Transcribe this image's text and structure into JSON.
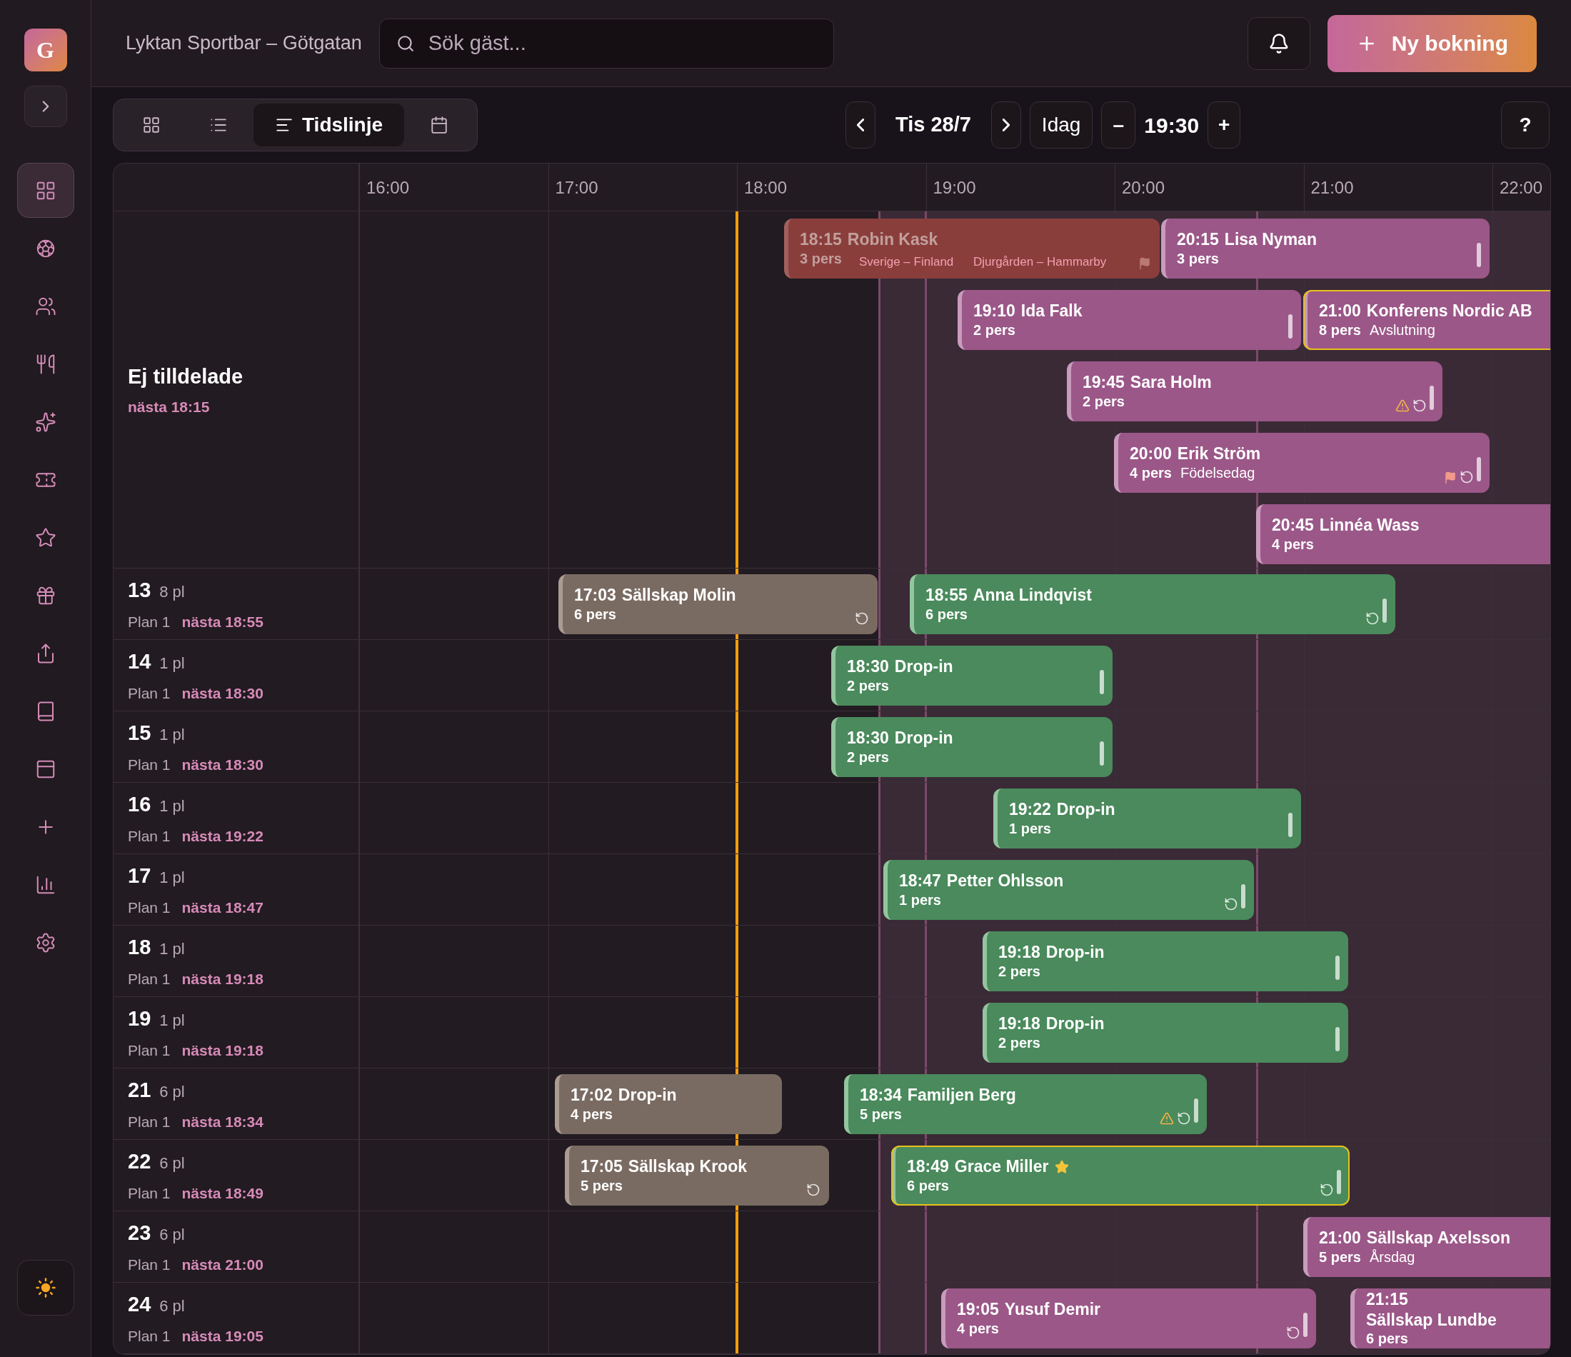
{
  "sidebar": {
    "logo_letter": "G",
    "nav_items": [
      {
        "kind": "grid",
        "selected": true
      },
      {
        "kind": "ball",
        "selected": false
      },
      {
        "kind": "users",
        "selected": false
      },
      {
        "kind": "utensils",
        "selected": false
      },
      {
        "kind": "sparkles",
        "selected": false
      },
      {
        "kind": "ticket",
        "selected": false
      },
      {
        "kind": "star",
        "selected": false
      },
      {
        "kind": "gift",
        "selected": false
      },
      {
        "kind": "share",
        "selected": false
      },
      {
        "kind": "book",
        "selected": false
      },
      {
        "kind": "panel",
        "selected": false
      },
      {
        "kind": "plus",
        "selected": false
      },
      {
        "kind": "chart",
        "selected": false
      },
      {
        "kind": "settings",
        "selected": false
      }
    ]
  },
  "header": {
    "title": "Lyktan Sportbar – Götgatan",
    "search": {
      "placeholder": "Sök gäst..."
    },
    "new_booking_button": "Ny bokning"
  },
  "view_tabs": [
    {
      "kind": "grid",
      "selected": false
    },
    {
      "kind": "list",
      "selected": false
    },
    {
      "kind": "timeline",
      "label": "Tidslinje",
      "selected": true
    },
    {
      "kind": "calendar",
      "selected": false
    }
  ],
  "date_nav": {
    "date": "Tis 28/7",
    "today_button": "Idag",
    "minus_button": "–",
    "time": "19:30",
    "plus_button": "+"
  },
  "help_button": "?",
  "timeline": {
    "hours": [
      "16:00",
      "17:00",
      "18:00",
      "19:00",
      "20:00",
      "21:00",
      "22:00"
    ],
    "events": [
      "Sverige – Finland",
      "Djurgården – Hammarby"
    ],
    "unassigned": {
      "title": "Ej tilldelade",
      "next": "nästa 18:15",
      "bookings": [
        {
          "time": "18:15",
          "name": "Robin Kask",
          "party": "3 pers",
          "kind": "cancelled",
          "highlighted": false,
          "starred": false,
          "handle": false,
          "warning": false,
          "repeat": false,
          "flag": true
        },
        {
          "time": "20:15",
          "name": "Lisa Nyman",
          "party": "3 pers",
          "kind": "booked",
          "highlighted": false,
          "starred": false,
          "handle": true,
          "warning": false,
          "repeat": false,
          "flag": false
        },
        {
          "time": "19:10",
          "name": "Ida Falk",
          "party": "2 pers",
          "kind": "booked",
          "highlighted": false,
          "starred": false,
          "handle": true,
          "warning": false,
          "repeat": false,
          "flag": false
        },
        {
          "time": "21:00",
          "name": "Konferens Nordic AB",
          "party": "8 pers",
          "note": "Avslutning",
          "kind": "booked",
          "highlighted": true,
          "starred": false,
          "handle": false,
          "warning": false,
          "repeat": false,
          "flag": false
        },
        {
          "time": "19:45",
          "name": "Sara Holm",
          "party": "2 pers",
          "kind": "booked",
          "highlighted": false,
          "starred": false,
          "handle": true,
          "warning": true,
          "repeat": true,
          "flag": false
        },
        {
          "time": "20:00",
          "name": "Erik Ström",
          "party": "4 pers",
          "note": "Födelsedag",
          "kind": "booked",
          "highlighted": false,
          "starred": false,
          "handle": true,
          "warning": false,
          "repeat": true,
          "flag": true
        },
        {
          "time": "20:45",
          "name": "Linnéa Wass",
          "party": "4 pers",
          "kind": "booked",
          "highlighted": false,
          "starred": false,
          "handle": false,
          "warning": false,
          "repeat": false,
          "flag": false
        }
      ]
    },
    "tables": [
      {
        "number": "13",
        "seats": "8 pl",
        "area": "Plan 1",
        "next": "nästa 18:55",
        "bookings": [
          {
            "time": "17:03",
            "name": "Sällskap Molin",
            "party": "6 pers",
            "kind": "finished",
            "highlighted": false,
            "starred": false,
            "handle": false,
            "warning": false,
            "repeat": true,
            "flag": false
          },
          {
            "time": "18:55",
            "name": "Anna Lindqvist",
            "party": "6 pers",
            "kind": "seated",
            "highlighted": false,
            "starred": false,
            "handle": true,
            "warning": false,
            "repeat": true,
            "flag": false
          }
        ]
      },
      {
        "number": "14",
        "seats": "1 pl",
        "area": "Plan 1",
        "next": "nästa 18:30",
        "bookings": [
          {
            "time": "18:30",
            "name": "Drop-in",
            "party": "2 pers",
            "kind": "seated",
            "highlighted": false,
            "starred": false,
            "handle": true,
            "warning": false,
            "repeat": false,
            "flag": false
          }
        ]
      },
      {
        "number": "15",
        "seats": "1 pl",
        "area": "Plan 1",
        "next": "nästa 18:30",
        "bookings": [
          {
            "time": "18:30",
            "name": "Drop-in",
            "party": "2 pers",
            "kind": "seated",
            "highlighted": false,
            "starred": false,
            "handle": true,
            "warning": false,
            "repeat": false,
            "flag": false
          }
        ]
      },
      {
        "number": "16",
        "seats": "1 pl",
        "area": "Plan 1",
        "next": "nästa 19:22",
        "bookings": [
          {
            "time": "19:22",
            "name": "Drop-in",
            "party": "1 pers",
            "kind": "seated",
            "highlighted": false,
            "starred": false,
            "handle": true,
            "warning": false,
            "repeat": false,
            "flag": false
          }
        ]
      },
      {
        "number": "17",
        "seats": "1 pl",
        "area": "Plan 1",
        "next": "nästa 18:47",
        "bookings": [
          {
            "time": "18:47",
            "name": "Petter Ohlsson",
            "party": "1 pers",
            "kind": "seated",
            "highlighted": false,
            "starred": false,
            "handle": true,
            "warning": false,
            "repeat": true,
            "flag": false
          }
        ]
      },
      {
        "number": "18",
        "seats": "1 pl",
        "area": "Plan 1",
        "next": "nästa 19:18",
        "bookings": [
          {
            "time": "19:18",
            "name": "Drop-in",
            "party": "2 pers",
            "kind": "seated",
            "highlighted": false,
            "starred": false,
            "handle": true,
            "warning": false,
            "repeat": false,
            "flag": false
          }
        ]
      },
      {
        "number": "19",
        "seats": "1 pl",
        "area": "Plan 1",
        "next": "nästa 19:18",
        "bookings": [
          {
            "time": "19:18",
            "name": "Drop-in",
            "party": "2 pers",
            "kind": "seated",
            "highlighted": false,
            "starred": false,
            "handle": true,
            "warning": false,
            "repeat": false,
            "flag": false
          }
        ]
      },
      {
        "number": "21",
        "seats": "6 pl",
        "area": "Plan 1",
        "next": "nästa 18:34",
        "bookings": [
          {
            "time": "17:02",
            "name": "Drop-in",
            "party": "4 pers",
            "kind": "finished",
            "highlighted": false,
            "starred": false,
            "handle": false,
            "warning": false,
            "repeat": false,
            "flag": false
          },
          {
            "time": "18:34",
            "name": "Familjen Berg",
            "party": "5 pers",
            "kind": "seated",
            "highlighted": false,
            "starred": false,
            "handle": true,
            "warning": true,
            "repeat": true,
            "flag": false
          }
        ]
      },
      {
        "number": "22",
        "seats": "6 pl",
        "area": "Plan 1",
        "next": "nästa 18:49",
        "bookings": [
          {
            "time": "17:05",
            "name": "Sällskap Krook",
            "party": "5 pers",
            "kind": "finished",
            "highlighted": false,
            "starred": false,
            "handle": false,
            "warning": false,
            "repeat": true,
            "flag": false
          },
          {
            "time": "18:49",
            "name": "Grace Miller",
            "party": "6 pers",
            "kind": "seated",
            "highlighted": true,
            "starred": true,
            "handle": true,
            "warning": false,
            "repeat": true,
            "flag": false
          }
        ]
      },
      {
        "number": "23",
        "seats": "6 pl",
        "area": "Plan 1",
        "next": "nästa 21:00",
        "bookings": [
          {
            "time": "21:00",
            "name": "Sällskap Axelsson",
            "party": "5 pers",
            "note": "Årsdag",
            "kind": "booked",
            "highlighted": false,
            "starred": false,
            "handle": false,
            "warning": false,
            "repeat": false,
            "flag": false
          }
        ]
      },
      {
        "number": "24",
        "seats": "6 pl",
        "area": "Plan 1",
        "next": "nästa 19:05",
        "bookings": [
          {
            "time": "19:05",
            "name": "Yusuf Demir",
            "party": "4 pers",
            "kind": "booked",
            "highlighted": false,
            "starred": false,
            "handle": true,
            "warning": false,
            "repeat": true,
            "flag": false
          },
          {
            "time": "21:15",
            "name": "Sällskap Lundbe",
            "party": "6 pers",
            "kind": "booked",
            "highlighted": false,
            "starred": false,
            "handle": false,
            "warning": false,
            "repeat": false,
            "flag": false
          }
        ]
      }
    ]
  }
}
